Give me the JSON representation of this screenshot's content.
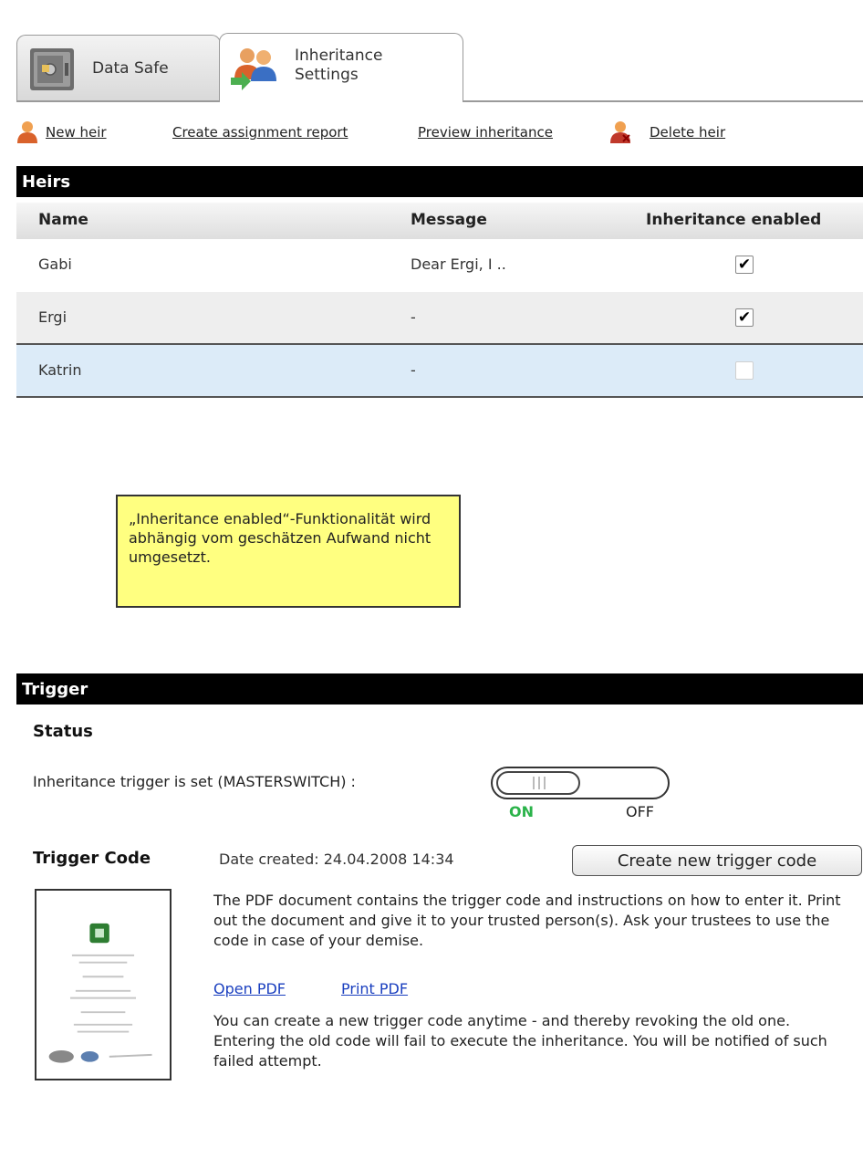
{
  "tabs": [
    {
      "label": "Data Safe",
      "active": false
    },
    {
      "label": "Inheritance Settings",
      "active": true
    }
  ],
  "toolbar": {
    "new_heir": "New heir",
    "create_report": "Create assignment report",
    "preview": "Preview inheritance",
    "delete_heir": "Delete heir"
  },
  "heirs": {
    "title": "Heirs",
    "columns": [
      "Name",
      "Message",
      "Inheritance enabled"
    ],
    "rows": [
      {
        "name": "Gabi",
        "message": "Dear Ergi, I ..",
        "enabled": true,
        "selected": false
      },
      {
        "name": "Ergi",
        "message": "-",
        "enabled": true,
        "selected": false
      },
      {
        "name": "Katrin",
        "message": "-",
        "enabled": false,
        "selected": true
      }
    ]
  },
  "note": {
    "text": "„Inheritance enabled“-Funktionalität wird abhängig vom geschätzen Aufwand nicht umgesetzt."
  },
  "trigger": {
    "title": "Trigger",
    "status_title": "Status",
    "masterswitch_label": "Inheritance trigger is set (MASTERSWITCH) :",
    "on_label": "ON",
    "off_label": "OFF",
    "switch_state": "on",
    "code_title": "Trigger Code",
    "date_created": "Date created: 24.04.2008 14:34",
    "create_button": "Create new trigger code",
    "description": "The PDF document contains the trigger code and instructions on how to enter it. Print out the document and give it to your trusted person(s). Ask your trustees to use the code in case of your demise.",
    "open_pdf": "Open PDF",
    "print_pdf": "Print PDF",
    "revoke_text": "You can create a new trigger code anytime - and thereby revoking the old one. Entering the old code will fail to execute the inheritance. You will be notified of such failed attempt."
  },
  "colors": {
    "header_bg": "#000000",
    "selected_row": "#dcebf8",
    "alt_row": "#eeeeee",
    "note_bg": "#ffff80",
    "on_color": "#2bb34a",
    "link_color": "#1a3fbf"
  }
}
